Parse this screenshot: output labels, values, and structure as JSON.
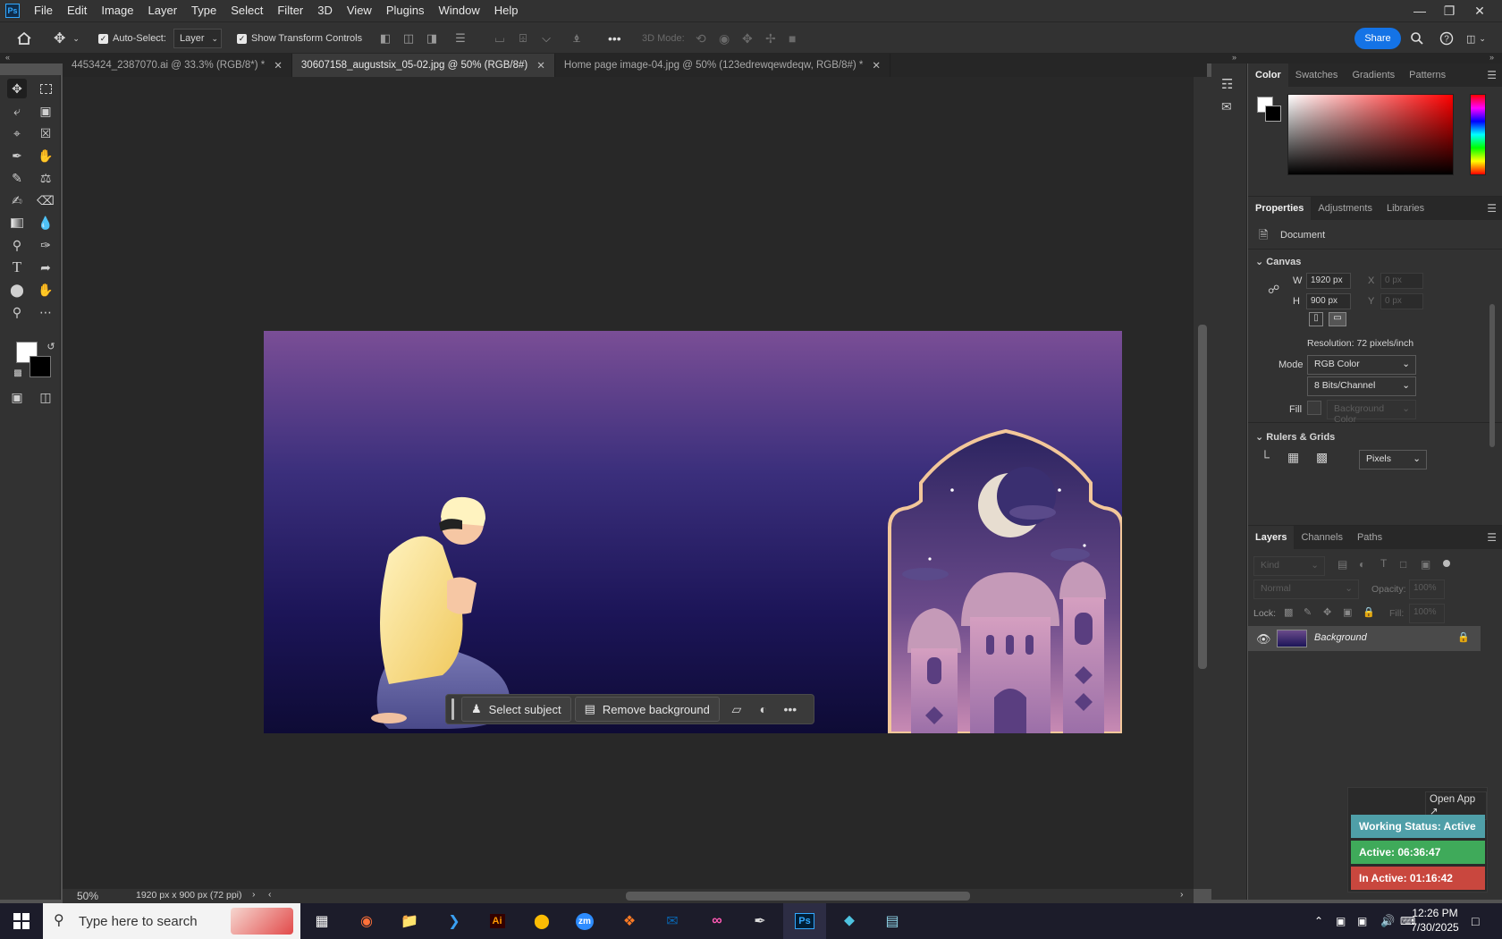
{
  "app": {
    "logo": "Ps"
  },
  "menu": [
    "File",
    "Edit",
    "Image",
    "Layer",
    "Type",
    "Select",
    "Filter",
    "3D",
    "View",
    "Plugins",
    "Window",
    "Help"
  ],
  "options": {
    "auto_select_label": "Auto-Select:",
    "layer_select": "Layer",
    "transform_label": "Show Transform Controls",
    "mode_3d": "3D Mode:",
    "share": "Share",
    "more": "•••"
  },
  "tabs": [
    {
      "label": "4453424_2387070.ai @ 33.3% (RGB/8*) *",
      "active": false
    },
    {
      "label": "30607158_augustsix_05-02.jpg @ 50% (RGB/8#)",
      "active": true
    },
    {
      "label": "Home page image-04.jpg @ 50% (123edrewqewdeqw, RGB/8#) *",
      "active": false
    }
  ],
  "context_bar": {
    "select_subject": "Select subject",
    "remove_background": "Remove background",
    "more": "•••"
  },
  "status": {
    "zoom": "50%",
    "doc_info": "1920 px x 900 px (72 ppi)"
  },
  "color_panel": {
    "tabs": [
      "Color",
      "Swatches",
      "Gradients",
      "Patterns"
    ]
  },
  "properties": {
    "tabs": [
      "Properties",
      "Adjustments",
      "Libraries"
    ],
    "doc_label": "Document",
    "canvas_title": "Canvas",
    "w_label": "W",
    "w_value": "1920 px",
    "h_label": "H",
    "h_value": "900 px",
    "x_label": "X",
    "x_value": "0 px",
    "y_label": "Y",
    "y_value": "0 px",
    "resolution": "Resolution: 72 pixels/inch",
    "mode_label": "Mode",
    "mode_value": "RGB Color",
    "bits_value": "8 Bits/Channel",
    "fill_label": "Fill",
    "fill_value": "Background Color",
    "rulers_title": "Rulers & Grids",
    "units_value": "Pixels"
  },
  "layers": {
    "tabs": [
      "Layers",
      "Channels",
      "Paths"
    ],
    "kind_placeholder": "Kind",
    "blend_mode": "Normal",
    "opacity_label": "Opacity:",
    "opacity_value": "100%",
    "lock_label": "Lock:",
    "fill_label": "Fill:",
    "fill_value": "100%",
    "layer_name": "Background"
  },
  "status_widget": {
    "open_app": "Open App ↗",
    "working": "Working Status: Active",
    "active": "Active: 06:36:47",
    "inactive": "In Active: 01:16:42"
  },
  "taskbar": {
    "search_placeholder": "Type here to search",
    "time": "12:26 PM",
    "date": "7/30/2025"
  },
  "colors": {
    "accent": "#1473e6",
    "working": "#4f9fa8",
    "active": "#3faa5a",
    "inactive": "#c9473e"
  }
}
